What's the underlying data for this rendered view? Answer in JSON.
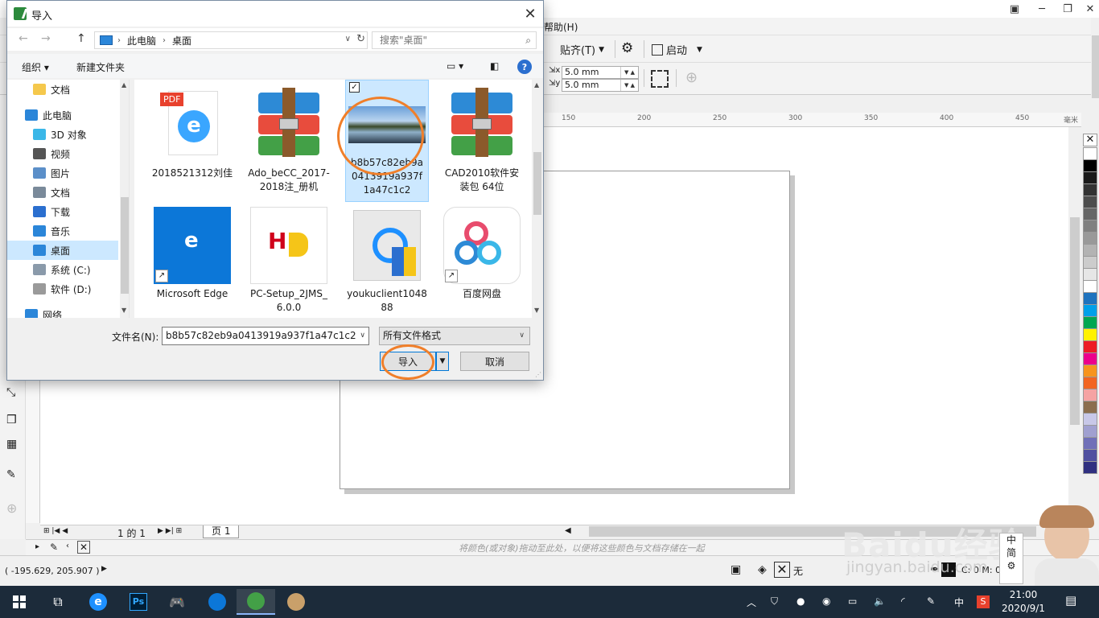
{
  "app": {
    "menu_help": "帮助(H)",
    "toolbar": {
      "snap_label": "贴齐(T)",
      "launch_label": "启动"
    },
    "nudge": {
      "x_value": "5.0 mm",
      "y_value": "5.0 mm"
    },
    "ruler_labels": [
      "150",
      "200",
      "250",
      "300",
      "350",
      "400",
      "450"
    ],
    "ruler_unit": "毫米",
    "page_nav": {
      "page_count_text": "1 的 1",
      "page_tab": "页 1"
    },
    "color_hint": "将颜色(或对象)拖动至此处，以便将这些颜色与文档存储在一起",
    "status": {
      "coords": "( -195.629, 205.907 )",
      "fill_none": "无",
      "cmyk": "C: 0 M: 0"
    },
    "palette_colors": [
      "#ffffff",
      "#000000",
      "#1a1a1a",
      "#333333",
      "#4d4d4d",
      "#666666",
      "#808080",
      "#999999",
      "#b3b3b3",
      "#cccccc",
      "#e6e6e6",
      "#ffffff",
      "#1e73be",
      "#00a0e9",
      "#00a651",
      "#fff200",
      "#ed1c24",
      "#ec008c",
      "#f7941d",
      "#f26522",
      "#f5a3a3",
      "#8b6e4e",
      "#c8c8e8",
      "#a0a0d0",
      "#7070b8",
      "#5050a0",
      "#303080"
    ]
  },
  "dialog": {
    "title": "导入",
    "breadcrumb": [
      "此电脑",
      "桌面"
    ],
    "search_placeholder": "搜索\"桌面\"",
    "organize_label": "组织 ▾",
    "new_folder_label": "新建文件夹",
    "help_symbol": "?",
    "nav_items": [
      {
        "label": "文档",
        "icon": "folder-icon"
      },
      {
        "label": "此电脑",
        "icon": "computer-icon"
      },
      {
        "label": "3D 对象",
        "icon": "3d-objects-icon"
      },
      {
        "label": "视频",
        "icon": "video-icon"
      },
      {
        "label": "图片",
        "icon": "pictures-icon"
      },
      {
        "label": "文档",
        "icon": "documents-icon"
      },
      {
        "label": "下载",
        "icon": "download-icon"
      },
      {
        "label": "音乐",
        "icon": "music-icon"
      },
      {
        "label": "桌面",
        "icon": "desktop-icon"
      },
      {
        "label": "系统 (C:)",
        "icon": "drive-c-icon"
      },
      {
        "label": "软件 (D:)",
        "icon": "drive-d-icon"
      },
      {
        "label": "网络",
        "icon": "network-icon"
      }
    ],
    "files": [
      {
        "name": "2018521312刘佳",
        "icon": "pdf-file-icon",
        "badge": "PDF"
      },
      {
        "name": "Ado_beCC_2017-2018注_册机",
        "icon": "winrar-archive-icon"
      },
      {
        "name": "b8b57c82eb9a0413919a937f1a47c1c2",
        "icon": "landscape-image-icon"
      },
      {
        "name": "CAD2010软件安装包 64位",
        "icon": "winrar-archive-icon"
      },
      {
        "name": "Microsoft Edge",
        "icon": "edge-shortcut-icon"
      },
      {
        "name": "PC-Setup_2JMS_6.0.0",
        "icon": "installer-icon"
      },
      {
        "name": "youkuclient104888",
        "icon": "youku-installer-icon"
      },
      {
        "name": "百度网盘",
        "icon": "baidu-netdisk-icon"
      }
    ],
    "filename_label": "文件名(N):",
    "filename_value": "b8b57c82eb9a0413919a937f1a47c1c2",
    "filetype_value": "所有文件格式",
    "import_label": "导入",
    "cancel_label": "取消"
  },
  "taskbar": {
    "ime_label": "中",
    "time": "21:00",
    "date": "2020/9/1"
  },
  "watermark": {
    "brand": "Baidu经验",
    "url": "jingyan.baidu.com"
  }
}
